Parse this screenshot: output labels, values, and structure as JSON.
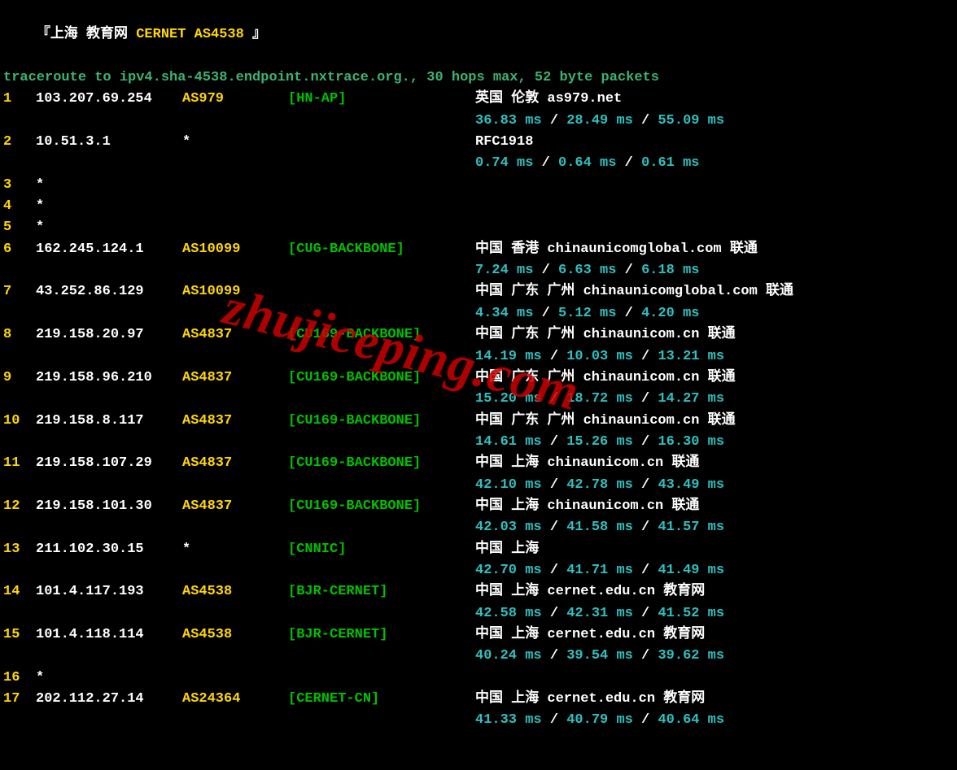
{
  "header": {
    "open_bracket": "『",
    "title_white": "上海 教育网 ",
    "title_yellow": "CERNET AS4538 ",
    "close_bracket": "』"
  },
  "traceroute_line": "traceroute to ipv4.sha-4538.endpoint.nxtrace.org., 30 hops max, 52 byte packets",
  "watermark": "zhujiceping.com",
  "hops": [
    {
      "num": "1",
      "ip": "103.207.69.254",
      "asn": "AS979",
      "tag": "[HN-AP]",
      "loc": "英国 伦敦  as979.net",
      "rtt": [
        "36.83 ms",
        "28.49 ms",
        "55.09 ms"
      ]
    },
    {
      "num": "2",
      "ip": "10.51.3.1",
      "asn": "*",
      "tag": "",
      "loc": "RFC1918",
      "rtt": [
        "0.74 ms",
        "0.64 ms",
        "0.61 ms"
      ]
    },
    {
      "num": "3",
      "ip": "*",
      "asn": "",
      "tag": "",
      "loc": "",
      "rtt": []
    },
    {
      "num": "4",
      "ip": "*",
      "asn": "",
      "tag": "",
      "loc": "",
      "rtt": []
    },
    {
      "num": "5",
      "ip": "*",
      "asn": "",
      "tag": "",
      "loc": "",
      "rtt": []
    },
    {
      "num": "6",
      "ip": "162.245.124.1",
      "asn": "AS10099",
      "tag": "[CUG-BACKBONE]",
      "loc": "中国 香港   chinaunicomglobal.com  联通",
      "rtt": [
        "7.24 ms",
        "6.63 ms",
        "6.18 ms"
      ]
    },
    {
      "num": "7",
      "ip": "43.252.86.129",
      "asn": "AS10099",
      "tag": "",
      "loc": "中国 广东 广州  chinaunicomglobal.com  联通",
      "rtt": [
        "4.34 ms",
        "5.12 ms",
        "4.20 ms"
      ]
    },
    {
      "num": "8",
      "ip": "219.158.20.97",
      "asn": "AS4837",
      "tag": "[CU169-BACKBONE]",
      "loc": "中国 广东 广州  chinaunicom.cn  联通",
      "rtt": [
        "14.19 ms",
        "10.03 ms",
        "13.21 ms"
      ]
    },
    {
      "num": "9",
      "ip": "219.158.96.210",
      "asn": "AS4837",
      "tag": "[CU169-BACKBONE]",
      "loc": "中国 广东 广州  chinaunicom.cn  联通",
      "rtt": [
        "15.20 ms",
        "18.72 ms",
        "14.27 ms"
      ]
    },
    {
      "num": "10",
      "ip": "219.158.8.117",
      "asn": "AS4837",
      "tag": "[CU169-BACKBONE]",
      "loc": "中国 广东 广州  chinaunicom.cn  联通",
      "rtt": [
        "14.61 ms",
        "15.26 ms",
        "16.30 ms"
      ]
    },
    {
      "num": "11",
      "ip": "219.158.107.29",
      "asn": "AS4837",
      "tag": "[CU169-BACKBONE]",
      "loc": "中国 上海   chinaunicom.cn  联通",
      "rtt": [
        "42.10 ms",
        "42.78 ms",
        "43.49 ms"
      ]
    },
    {
      "num": "12",
      "ip": "219.158.101.30",
      "asn": "AS4837",
      "tag": "[CU169-BACKBONE]",
      "loc": "中国 上海   chinaunicom.cn  联通",
      "rtt": [
        "42.03 ms",
        "41.58 ms",
        "41.57 ms"
      ]
    },
    {
      "num": "13",
      "ip": "211.102.30.15",
      "asn": "*",
      "tag": "[CNNIC]",
      "loc": "中国 上海",
      "rtt": [
        "42.70 ms",
        "41.71 ms",
        "41.49 ms"
      ]
    },
    {
      "num": "14",
      "ip": "101.4.117.193",
      "asn": "AS4538",
      "tag": "[BJR-CERNET]",
      "loc": "中国 上海  cernet.edu.cn  教育网",
      "rtt": [
        "42.58 ms",
        "42.31 ms",
        "41.52 ms"
      ]
    },
    {
      "num": "15",
      "ip": "101.4.118.114",
      "asn": "AS4538",
      "tag": "[BJR-CERNET]",
      "loc": "中国 上海  cernet.edu.cn  教育网",
      "rtt": [
        "40.24 ms",
        "39.54 ms",
        "39.62 ms"
      ]
    },
    {
      "num": "16",
      "ip": "*",
      "asn": "",
      "tag": "",
      "loc": "",
      "rtt": []
    },
    {
      "num": "17",
      "ip": "202.112.27.14",
      "asn": "AS24364",
      "tag": "[CERNET-CN]",
      "loc": "中国 上海  cernet.edu.cn  教育网",
      "rtt": [
        "41.33 ms",
        "40.79 ms",
        "40.64 ms"
      ]
    }
  ]
}
